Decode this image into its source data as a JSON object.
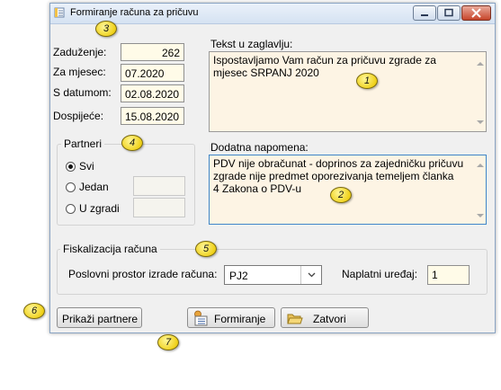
{
  "window": {
    "title": "Formiranje računa za pričuvu",
    "controls": [
      "minimize-icon",
      "maximize-icon",
      "close-icon"
    ]
  },
  "fields": {
    "zaduzenje": {
      "label": "Zaduženje:",
      "value": "262"
    },
    "za_mjesec": {
      "label": "Za mjesec:",
      "value": "07.2020"
    },
    "s_datumom": {
      "label": "S datumom:",
      "value": "02.08.2020"
    },
    "dospijece": {
      "label": "Dospijeće:",
      "value": "15.08.2020"
    }
  },
  "header_text": {
    "label": "Tekst u zaglavlju:",
    "value": "Ispostavljamo Vam račun za pričuvu zgrade za\nmjesec SRPANJ 2020"
  },
  "note": {
    "label": "Dodatna napomena:",
    "value": "PDV nije obračunat - doprinos za zajedničku pričuvu\nzgrade nije predmet oporezivanja temeljem članka\n4 Zakona o PDV-u"
  },
  "partners": {
    "title": "Partneri",
    "options": [
      {
        "label": "Svi",
        "checked": true
      },
      {
        "label": "Jedan",
        "checked": false
      },
      {
        "label": "U zgradi",
        "checked": false
      }
    ]
  },
  "fiscal": {
    "title": "Fiskalizacija računa",
    "space_label": "Poslovni prostor izrade računa:",
    "space_value": "PJ2",
    "device_label": "Naplatni uređaj:",
    "device_value": "1"
  },
  "buttons": {
    "show_partners": "Prikaži partnere",
    "generate": "Formiranje",
    "close": "Zatvori"
  },
  "callouts": [
    "1",
    "2",
    "3",
    "4",
    "5",
    "6",
    "7"
  ],
  "colors": {
    "callout_fill": "#f0d21c",
    "field_background": "#fffbe8",
    "title_bar": "#dbe6f4",
    "close_button": "#c7452a"
  }
}
